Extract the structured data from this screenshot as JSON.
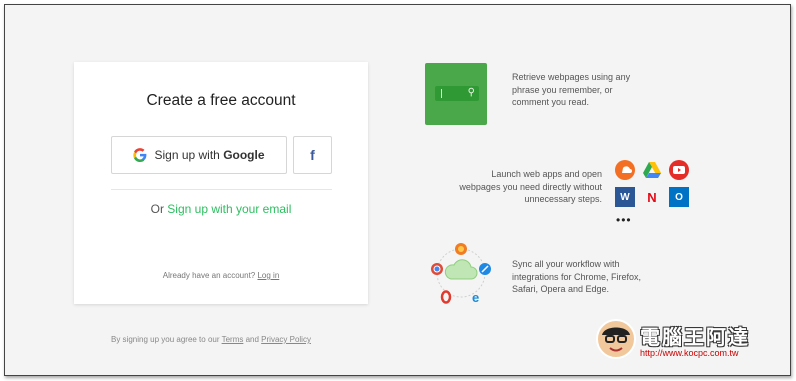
{
  "signup": {
    "title": "Create a free account",
    "google_prefix": "Sign up with ",
    "google_brand": "Google",
    "facebook_glyph": "f",
    "or_text": "Or ",
    "email_link": "Sign up with your email",
    "have_account": "Already have an account? ",
    "login_link": "Log in"
  },
  "terms": {
    "prefix": "By signing up you agree to our ",
    "terms_link": "Terms",
    "and": " and ",
    "privacy_link": "Privacy Policy"
  },
  "features": [
    {
      "text_lines": [
        "Retrieve webpages using any",
        "phrase you remember, or",
        "comment you read."
      ],
      "icon": "search-icon"
    },
    {
      "text_lines": [
        "Launch web apps and open",
        "webpages you need directly without",
        "unnecessary steps."
      ],
      "icon": "app-icons"
    },
    {
      "text_lines": [
        "Sync all your workflow with",
        "integrations for Chrome, Firefox,",
        "Safari, Opera and Edge."
      ],
      "icon": "browser-cloud-icon"
    }
  ],
  "app_icons": [
    {
      "name": "soundcloud-icon",
      "color": "#f26f23"
    },
    {
      "name": "google-drive-icon",
      "color": "#2da94f"
    },
    {
      "name": "youtube-icon",
      "color": "#e52d27"
    },
    {
      "name": "word-icon",
      "color": "#2b5797",
      "glyph": "W"
    },
    {
      "name": "netflix-icon",
      "color": "#e50914",
      "glyph": "N"
    },
    {
      "name": "outlook-icon",
      "color": "#0072c6",
      "glyph": "O"
    }
  ],
  "more_glyph": "•••",
  "watermark": {
    "title": "電腦王阿達",
    "url": "http://www.kocpc.com.tw"
  },
  "colors": {
    "accent": "#2dbe60",
    "tile_green": "#4aa84a",
    "background": "#f4f4f4"
  }
}
